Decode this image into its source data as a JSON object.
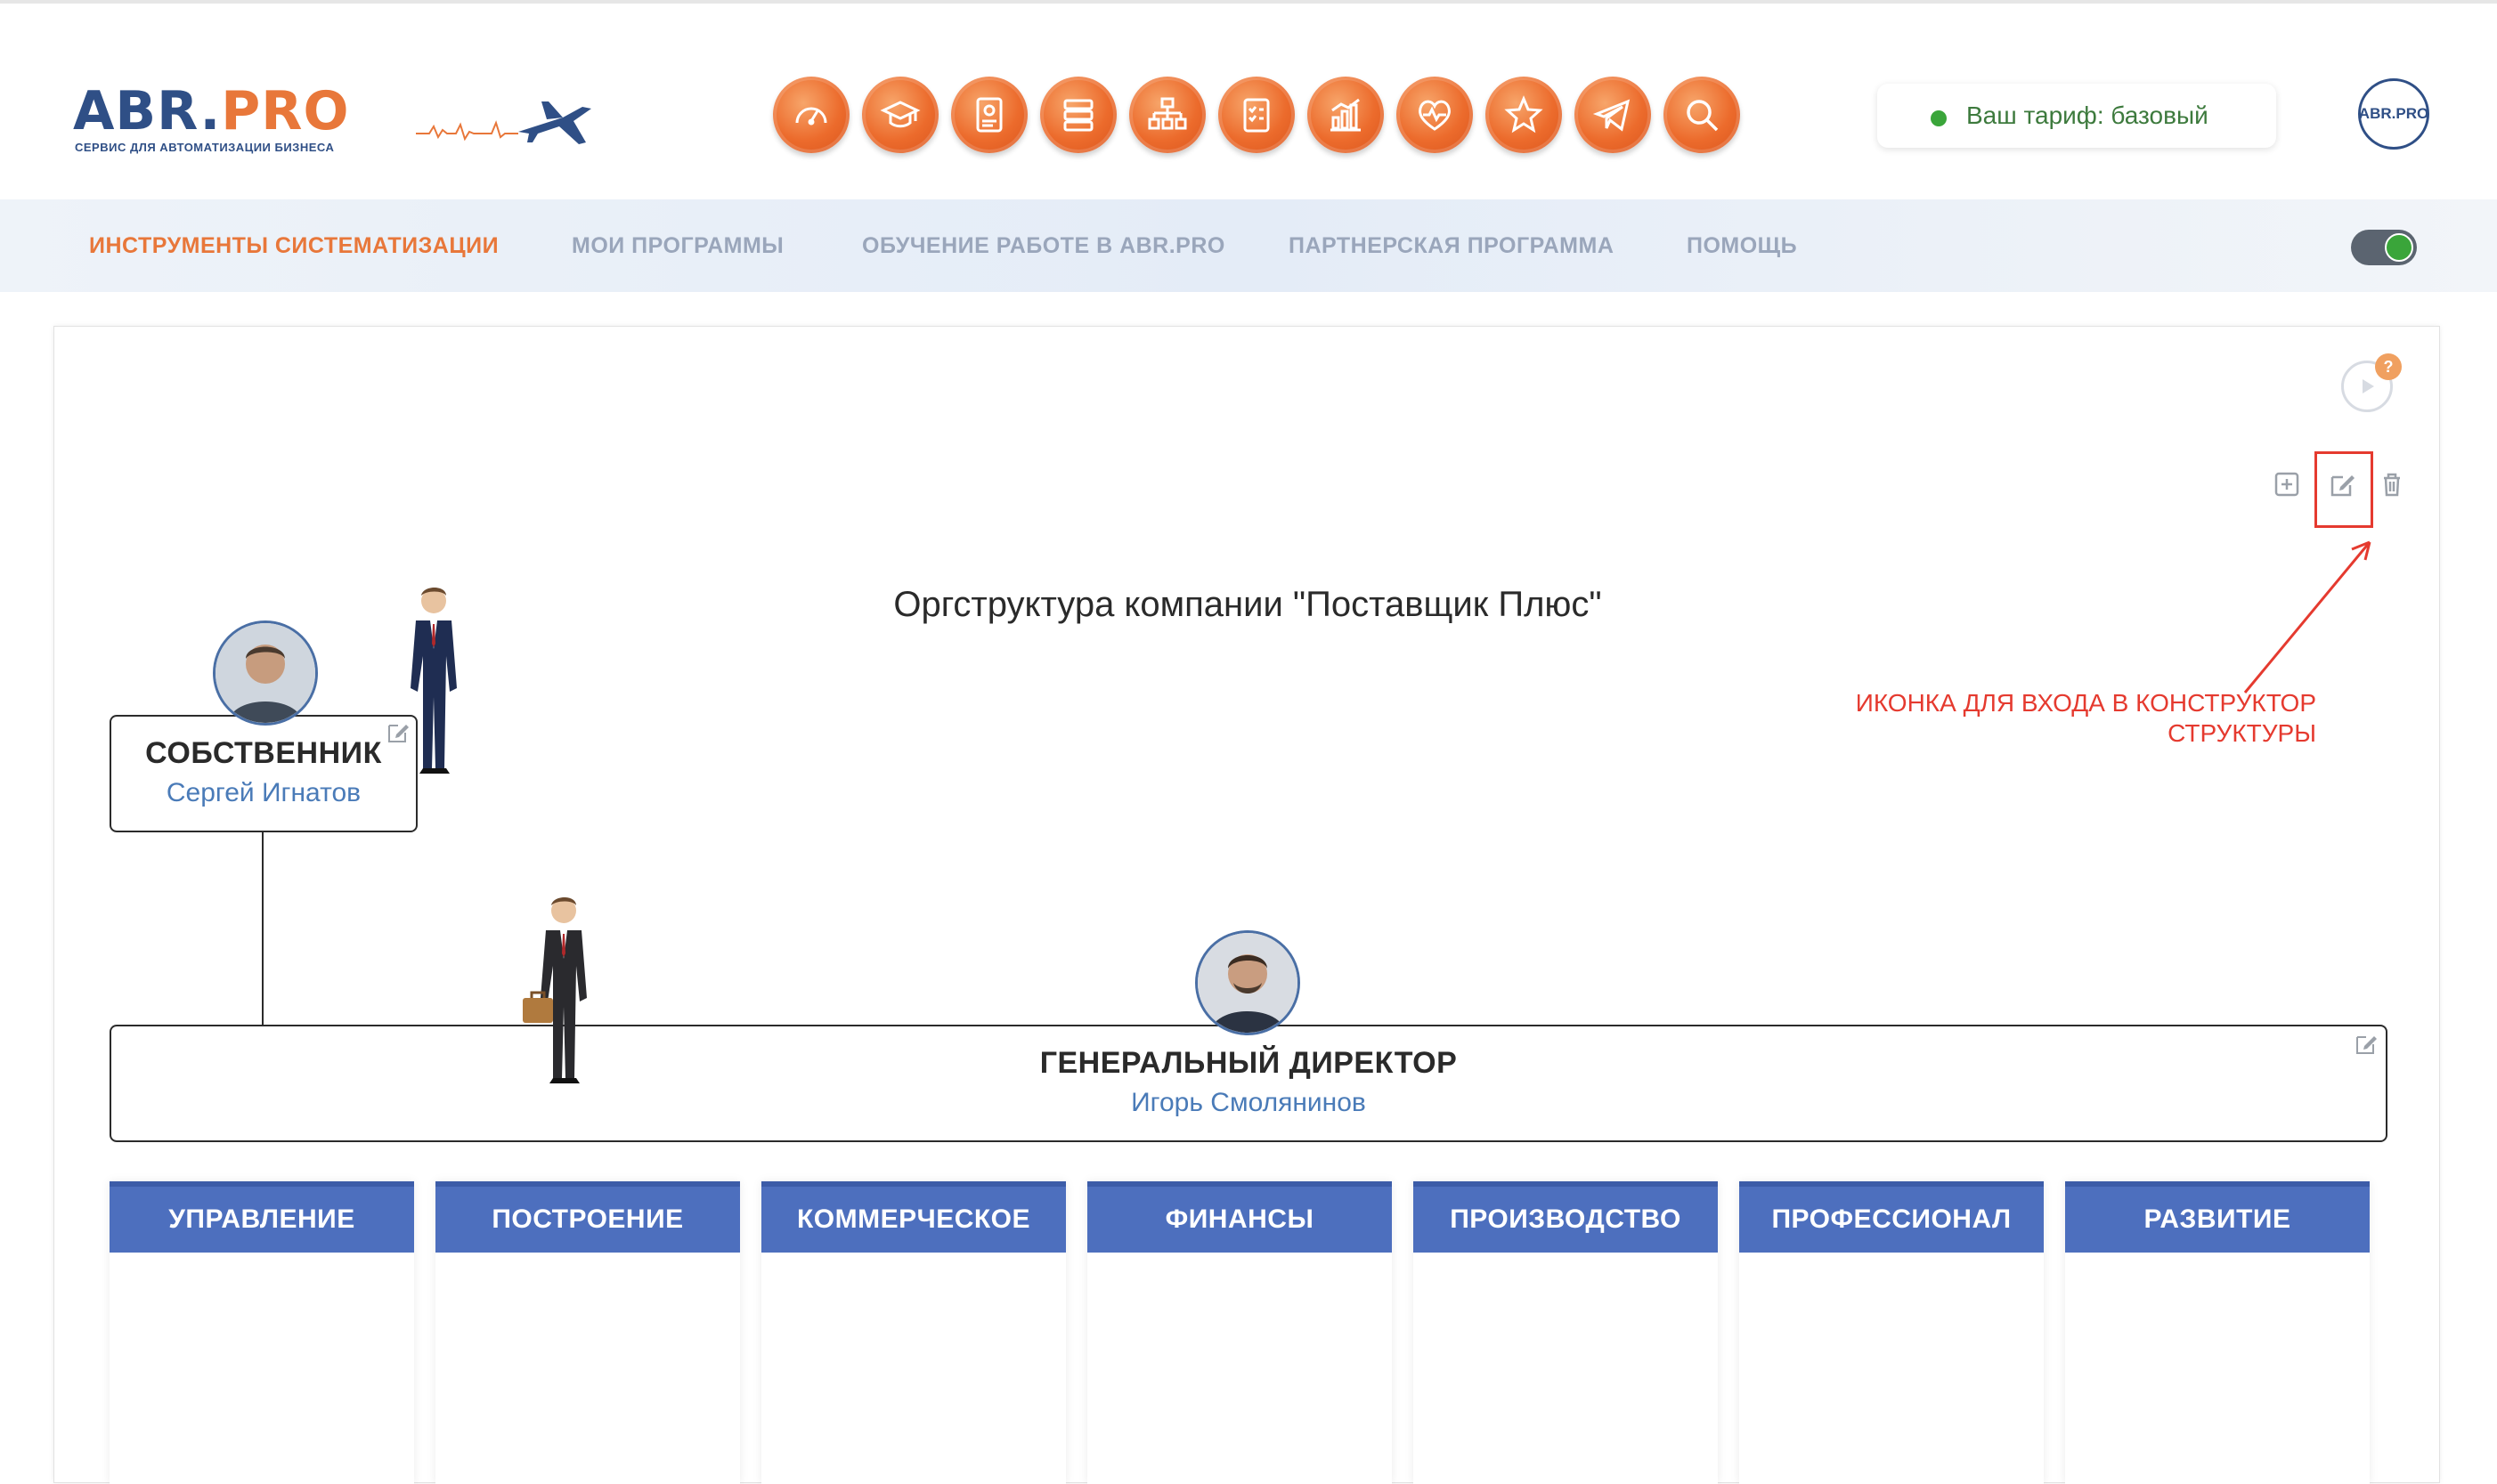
{
  "header": {
    "logo_abr": "ABR.",
    "logo_pro": "PRO",
    "logo_sub": "СЕРВИС ДЛЯ АВТОМАТИЗАЦИИ БИЗНЕСА",
    "tools": [
      "speedometer-icon",
      "graduation-cap-icon",
      "document-gear-icon",
      "stack-icon",
      "org-chart-icon",
      "checklist-icon",
      "bar-chart-icon",
      "heart-icon",
      "star-icon",
      "telegram-icon",
      "search-icon"
    ],
    "tariff": "Ваш тариф: базовый",
    "avatar_text": "ABR.PRO"
  },
  "nav": {
    "items": [
      {
        "label": "ИНСТРУМЕНТЫ СИСТЕМАТИЗАЦИИ",
        "active": true
      },
      {
        "label": "МОИ ПРОГРАММЫ",
        "active": false
      },
      {
        "label": "ОБУЧЕНИЕ РАБОТЕ В ABR.PRO",
        "active": false
      },
      {
        "label": "ПАРТНЕРСКАЯ ПРОГРАММА",
        "active": false
      },
      {
        "label": "ПОМОЩЬ",
        "active": false
      }
    ],
    "toggle_on": true
  },
  "panel": {
    "help_badge": "?",
    "title": "Оргструктура компании \"Поставщик Плюс\"",
    "annotation": "ИКОНКА ДЛЯ  ВХОДА В КОНСТРУКТОР СТРУКТУРЫ",
    "owner": {
      "role": "СОБСТВЕННИК",
      "name": "Сергей Игнатов"
    },
    "ceo": {
      "role": "ГЕНЕРАЛЬНЫЙ ДИРЕКТОР",
      "name": "Игорь Смолянинов"
    },
    "departments": [
      "УПРАВЛЕНИЕ",
      "ПОСТРОЕНИЕ",
      "КОММЕРЧЕСКОЕ",
      "ФИНАНСЫ",
      "ПРОИЗВОДСТВО",
      "ПРОФЕССИОНАЛ",
      "РАЗВИТИЕ"
    ]
  },
  "colors": {
    "accent_orange": "#e8773a",
    "brand_blue": "#2f4f86",
    "dept_blue": "#4d6fbe",
    "annotation_red": "#e53a2f",
    "status_green": "#3aa53a"
  }
}
